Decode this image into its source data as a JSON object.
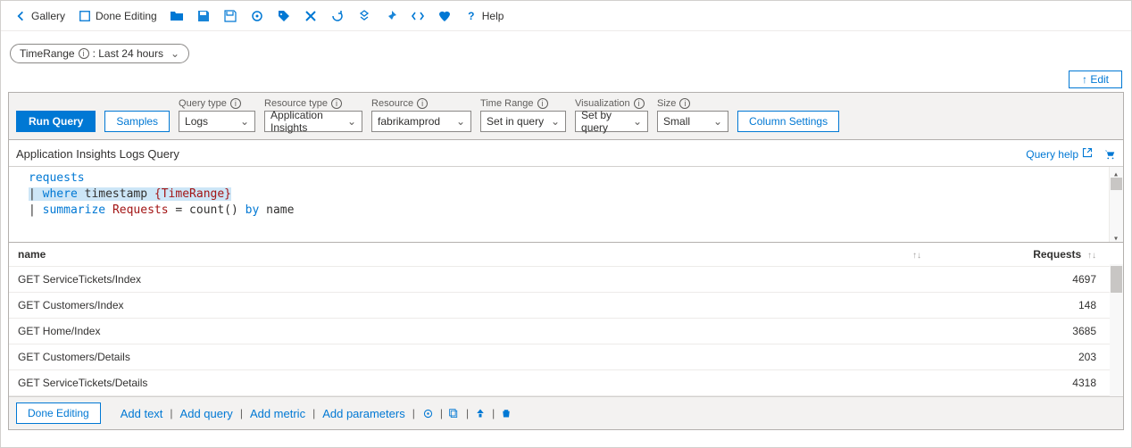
{
  "toolbar": {
    "gallery": "Gallery",
    "done_editing": "Done Editing",
    "help": "Help"
  },
  "param": {
    "label": "TimeRange",
    "value": ": Last 24 hours"
  },
  "edit_button": "↑ Edit",
  "config": {
    "run_query": "Run Query",
    "samples": "Samples",
    "query_type_label": "Query type",
    "query_type_value": "Logs",
    "resource_type_label": "Resource type",
    "resource_type_value": "Application Insights",
    "resource_label": "Resource",
    "resource_value": "fabrikamprod",
    "time_range_label": "Time Range",
    "time_range_value": "Set in query",
    "visualization_label": "Visualization",
    "visualization_value": "Set by query",
    "size_label": "Size",
    "size_value": "Small",
    "column_settings": "Column Settings"
  },
  "section_title": "Application Insights Logs Query",
  "query_help": "Query help",
  "code": {
    "line1_kw": "requests",
    "line2_kw": "where",
    "line2_ident": "timestamp",
    "line2_macro": "{TimeRange}",
    "line3_kw": "summarize",
    "line3_var": "Requests",
    "line3_eq": "=",
    "line3_fn": "count()",
    "line3_by": "by",
    "line3_col": "name"
  },
  "table": {
    "col_name": "name",
    "col_requests": "Requests",
    "rows": [
      {
        "name": "GET ServiceTickets/Index",
        "requests": "4697"
      },
      {
        "name": "GET Customers/Index",
        "requests": "148"
      },
      {
        "name": "GET Home/Index",
        "requests": "3685"
      },
      {
        "name": "GET Customers/Details",
        "requests": "203"
      },
      {
        "name": "GET ServiceTickets/Details",
        "requests": "4318"
      }
    ]
  },
  "footer": {
    "done_editing": "Done Editing",
    "add_text": "Add text",
    "add_query": "Add query",
    "add_metric": "Add metric",
    "add_parameters": "Add parameters"
  }
}
